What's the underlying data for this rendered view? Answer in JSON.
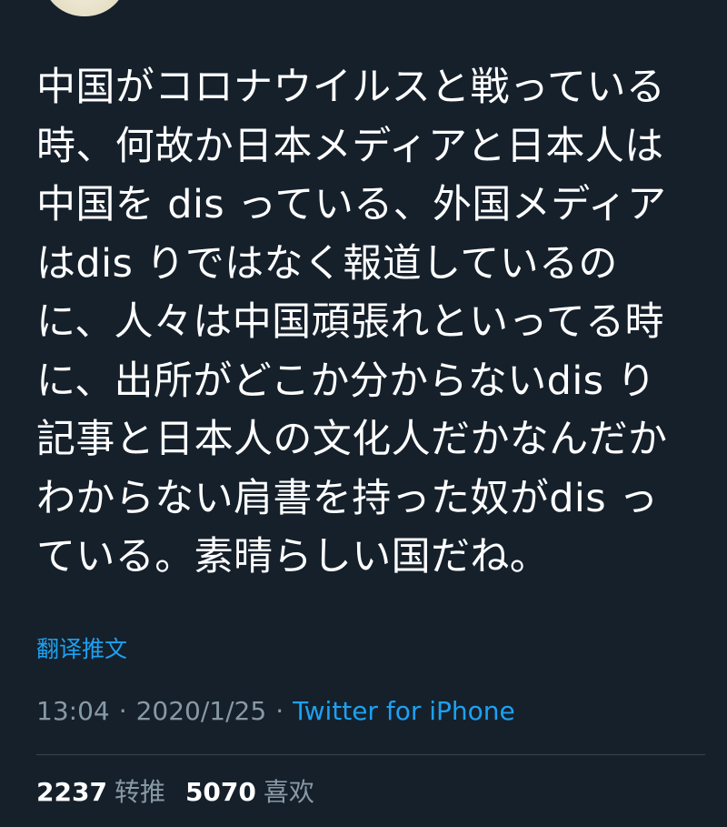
{
  "tweet": {
    "text_lines": [
      "中国がコロナウイルスと戦っている",
      "時、何故か日本メディアと日本人は",
      "中国を dis っている、外国メディア",
      "はdis りではなく報道しているの",
      "に、人々は中国頑張れといってる時",
      "に、出所がどこか分からないdis り",
      "記事と日本人の文化人だかなんだか",
      "わからない肩書を持った奴がdis っ",
      "ている。素晴らしい国だね。"
    ],
    "translate_label": "翻译推文",
    "time": "13:04",
    "separator": "·",
    "date": "2020/1/25",
    "source": "Twitter for iPhone"
  },
  "stats": {
    "retweets_count": "2237",
    "retweets_label": "转推",
    "likes_count": "5070",
    "likes_label": "喜欢"
  },
  "colors": {
    "background": "#15202b",
    "text": "#ffffff",
    "muted": "#8899a6",
    "accent": "#1da1f2",
    "divider": "#38444d"
  }
}
